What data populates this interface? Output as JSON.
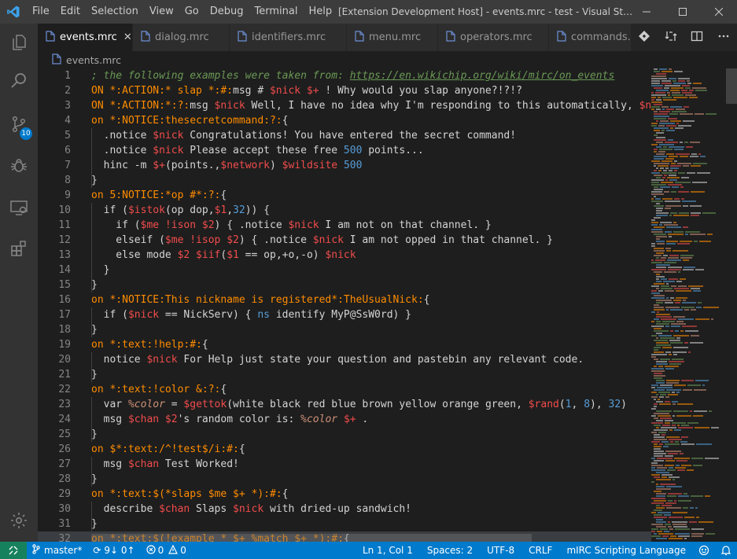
{
  "titlebar": {
    "menu": [
      "File",
      "Edit",
      "Selection",
      "View",
      "Go",
      "Debug",
      "Terminal",
      "Help"
    ],
    "title": "[Extension Development Host] - events.mrc - test - Visual Studio C..."
  },
  "tabs": [
    {
      "label": "events.mrc",
      "active": true
    },
    {
      "label": "dialog.mrc",
      "active": false
    },
    {
      "label": "identifiers.mrc",
      "active": false
    },
    {
      "label": "menu.mrc",
      "active": false
    },
    {
      "label": "operators.mrc",
      "active": false
    },
    {
      "label": "commands.mrc",
      "active": false
    }
  ],
  "breadcrumb": {
    "file": "events.mrc"
  },
  "activity": {
    "scm_badge": "10"
  },
  "code": [
    {
      "n": "1",
      "tokens": [
        [
          "c-comment",
          "; the following examples were taken from: "
        ],
        [
          "c-comment c-link",
          "https://en.wikichip.org/wiki/mirc/on_events"
        ]
      ]
    },
    {
      "n": "2",
      "tokens": [
        [
          "c-event",
          "ON *:ACTION:* slap *:#:"
        ],
        [
          "c-text",
          "msg # "
        ],
        [
          "c-var",
          "$nick $+"
        ],
        [
          "c-text",
          " ! Why would you slap anyone?!?!?"
        ]
      ]
    },
    {
      "n": "3",
      "tokens": [
        [
          "c-event",
          "ON *:ACTION:*:?:"
        ],
        [
          "c-text",
          "msg "
        ],
        [
          "c-var",
          "$nick"
        ],
        [
          "c-text",
          " Well, I have no idea why I'm responding to this automatically, "
        ],
        [
          "c-var",
          "$nick"
        ]
      ]
    },
    {
      "n": "4",
      "tokens": [
        [
          "c-event",
          "on *:NOTICE:thesecretcommand:?:"
        ],
        [
          "c-text",
          "{"
        ]
      ]
    },
    {
      "n": "5",
      "tokens": [
        [
          "c-text",
          "  "
        ],
        [
          "c-text",
          ".notice "
        ],
        [
          "c-var",
          "$nick"
        ],
        [
          "c-text",
          " Congratulations! You have entered the secret command!"
        ]
      ]
    },
    {
      "n": "6",
      "tokens": [
        [
          "c-text",
          "  "
        ],
        [
          "c-text",
          ".notice "
        ],
        [
          "c-var",
          "$nick"
        ],
        [
          "c-text",
          " Please accept these free "
        ],
        [
          "c-num",
          "500"
        ],
        [
          "c-text",
          " points..."
        ]
      ]
    },
    {
      "n": "7",
      "tokens": [
        [
          "c-text",
          "  hinc -m "
        ],
        [
          "c-var",
          "$+"
        ],
        [
          "c-text",
          "(points.,"
        ],
        [
          "c-var",
          "$network"
        ],
        [
          "c-text",
          ") "
        ],
        [
          "c-var",
          "$wildsite"
        ],
        [
          "c-text",
          " "
        ],
        [
          "c-num",
          "500"
        ]
      ]
    },
    {
      "n": "8",
      "tokens": [
        [
          "c-text",
          "}"
        ]
      ]
    },
    {
      "n": "9",
      "tokens": [
        [
          "c-event",
          "on 5:NOTICE:*op #*:?:"
        ],
        [
          "c-text",
          "{"
        ]
      ]
    },
    {
      "n": "10",
      "tokens": [
        [
          "c-text",
          "  if ("
        ],
        [
          "c-var",
          "$istok"
        ],
        [
          "c-text",
          "(op dop,"
        ],
        [
          "c-var",
          "$1"
        ],
        [
          "c-text",
          ","
        ],
        [
          "c-num",
          "32"
        ],
        [
          "c-text",
          ")) {"
        ]
      ]
    },
    {
      "n": "11",
      "tokens": [
        [
          "c-text",
          "    if ("
        ],
        [
          "c-var",
          "$me !ison $2"
        ],
        [
          "c-text",
          ") { .notice "
        ],
        [
          "c-var",
          "$nick"
        ],
        [
          "c-text",
          " I am not on that channel. }"
        ]
      ]
    },
    {
      "n": "12",
      "tokens": [
        [
          "c-text",
          "    elseif ("
        ],
        [
          "c-var",
          "$me !isop $2"
        ],
        [
          "c-text",
          ") { .notice "
        ],
        [
          "c-var",
          "$nick"
        ],
        [
          "c-text",
          " I am not opped in that channel. }"
        ]
      ]
    },
    {
      "n": "13",
      "tokens": [
        [
          "c-text",
          "    else mode "
        ],
        [
          "c-var",
          "$2 $iif"
        ],
        [
          "c-text",
          "("
        ],
        [
          "c-var",
          "$1"
        ],
        [
          "c-text",
          " == op,+o,-o) "
        ],
        [
          "c-var",
          "$nick"
        ]
      ]
    },
    {
      "n": "14",
      "tokens": [
        [
          "c-text",
          "  }"
        ]
      ]
    },
    {
      "n": "15",
      "tokens": [
        [
          "c-text",
          "}"
        ]
      ]
    },
    {
      "n": "16",
      "tokens": [
        [
          "c-event",
          "on *:NOTICE:This nickname is registered*:TheUsualNick:"
        ],
        [
          "c-text",
          "{"
        ]
      ]
    },
    {
      "n": "17",
      "tokens": [
        [
          "c-text",
          "  if ("
        ],
        [
          "c-var",
          "$nick"
        ],
        [
          "c-text",
          " == NickServ) { "
        ],
        [
          "c-cmd",
          "ns"
        ],
        [
          "c-text",
          " identify MyP@SsW0rd) }"
        ]
      ]
    },
    {
      "n": "18",
      "tokens": [
        [
          "c-text",
          "}"
        ]
      ]
    },
    {
      "n": "19",
      "tokens": [
        [
          "c-event",
          "on *:text:!help:#:"
        ],
        [
          "c-text",
          "{"
        ]
      ]
    },
    {
      "n": "20",
      "tokens": [
        [
          "c-text",
          "  notice "
        ],
        [
          "c-var",
          "$nick"
        ],
        [
          "c-text",
          " For Help just state your question and pastebin any relevant code."
        ]
      ]
    },
    {
      "n": "21",
      "tokens": [
        [
          "c-text",
          "}"
        ]
      ]
    },
    {
      "n": "22",
      "tokens": [
        [
          "c-event",
          "on *:text:!color &:?:"
        ],
        [
          "c-text",
          "{"
        ]
      ]
    },
    {
      "n": "23",
      "tokens": [
        [
          "c-text",
          "  var "
        ],
        [
          "c-lvar",
          "%color"
        ],
        [
          "c-text",
          " = "
        ],
        [
          "c-var",
          "$gettok"
        ],
        [
          "c-text",
          "(white black red blue brown yellow orange green, "
        ],
        [
          "c-var",
          "$rand"
        ],
        [
          "c-text",
          "("
        ],
        [
          "c-num",
          "1"
        ],
        [
          "c-text",
          ", "
        ],
        [
          "c-num",
          "8"
        ],
        [
          "c-text",
          "), "
        ],
        [
          "c-num",
          "32"
        ],
        [
          "c-text",
          ")"
        ]
      ]
    },
    {
      "n": "24",
      "tokens": [
        [
          "c-text",
          "  msg "
        ],
        [
          "c-var",
          "$chan $2"
        ],
        [
          "c-text",
          "'s random color is: "
        ],
        [
          "c-lvar",
          "%color"
        ],
        [
          "c-text",
          " "
        ],
        [
          "c-var",
          "$+"
        ],
        [
          "c-text",
          " ."
        ]
      ]
    },
    {
      "n": "25",
      "tokens": [
        [
          "c-text",
          "}"
        ]
      ]
    },
    {
      "n": "26",
      "tokens": [
        [
          "c-event",
          "on $*:text:/^!test$/i:#:"
        ],
        [
          "c-text",
          "{"
        ]
      ]
    },
    {
      "n": "27",
      "tokens": [
        [
          "c-text",
          "  msg "
        ],
        [
          "c-var",
          "$chan"
        ],
        [
          "c-text",
          " Test Worked!"
        ]
      ]
    },
    {
      "n": "28",
      "tokens": [
        [
          "c-text",
          "}"
        ]
      ]
    },
    {
      "n": "29",
      "tokens": [
        [
          "c-event",
          "on *:text:$(*slaps $me $+ *):#:"
        ],
        [
          "c-text",
          "{"
        ]
      ]
    },
    {
      "n": "30",
      "tokens": [
        [
          "c-text",
          "  describe "
        ],
        [
          "c-var",
          "$chan"
        ],
        [
          "c-text",
          " Slaps "
        ],
        [
          "c-var",
          "$nick"
        ],
        [
          "c-text",
          " with dried-up sandwich!"
        ]
      ]
    },
    {
      "n": "31",
      "tokens": [
        [
          "c-text",
          "}"
        ]
      ]
    },
    {
      "n": "32",
      "tokens": [
        [
          "c-event",
          "on *:text:$(!example * $+ %match $+ *):#:"
        ],
        [
          "c-text",
          "{"
        ]
      ]
    }
  ],
  "statusbar": {
    "branch": "master*",
    "sync": "9↓ 0↑",
    "errors": "0",
    "warnings": "0",
    "position": "Ln 1, Col 1",
    "spaces": "Spaces: 2",
    "encoding": "UTF-8",
    "eol": "CRLF",
    "language": "mIRC Scripting Language"
  },
  "colors": {
    "accent": "#007acc",
    "event": "#ff8c00",
    "variable": "#f14c4c",
    "number": "#569cd6",
    "comment": "#6a9955"
  }
}
